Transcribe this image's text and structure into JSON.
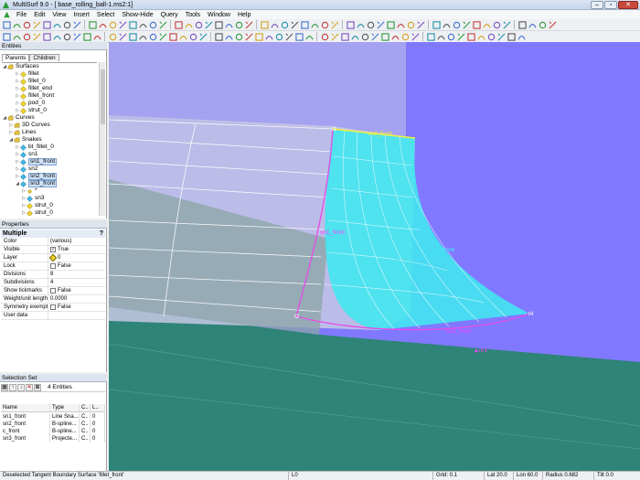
{
  "window": {
    "title": "MultiSurf 9.0 - [ base_rolling_ball-1.ms2:1]",
    "minimize": "–",
    "maximize": "▫",
    "close": "✕"
  },
  "menu": [
    "File",
    "Edit",
    "View",
    "Insert",
    "Select",
    "Show-Hide",
    "Query",
    "Tools",
    "Window",
    "Help"
  ],
  "entities": {
    "title": "Entities",
    "tabs": [
      "Parents",
      "Children"
    ],
    "tree": [
      {
        "label": "Surfaces",
        "icon": "folder-icon"
      },
      {
        "label": "fillet",
        "icon": "surface-icon"
      },
      {
        "label": "fillet_0",
        "icon": "surface-icon"
      },
      {
        "label": "fillet_end",
        "icon": "surface-icon"
      },
      {
        "label": "fillet_front",
        "icon": "surface-icon"
      },
      {
        "label": "pod_0",
        "icon": "surface-icon"
      },
      {
        "label": "strut_0",
        "icon": "surface-icon"
      },
      {
        "label": "Curves",
        "icon": "folder-icon"
      },
      {
        "label": "3D Curves",
        "icon": "folder-icon"
      },
      {
        "label": "Lines",
        "icon": "folder-icon"
      },
      {
        "label": "Snakes",
        "icon": "folder-icon"
      },
      {
        "label": "bt_fillet_0",
        "icon": "snake-icon"
      },
      {
        "label": "sn1",
        "icon": "snake-icon"
      },
      {
        "label": "sn1_front",
        "icon": "snake-icon"
      },
      {
        "label": "sn2",
        "icon": "snake-icon"
      },
      {
        "label": "sn2_front",
        "icon": "snake-icon"
      },
      {
        "label": "sn3_front",
        "icon": "snake-icon"
      },
      {
        "label": "*",
        "icon": "point-icon"
      },
      {
        "label": "sn3",
        "icon": "snake-icon"
      },
      {
        "label": "strut_0",
        "icon": "surface-icon"
      },
      {
        "label": "strut_0",
        "icon": "surface-icon"
      }
    ]
  },
  "properties": {
    "title": "Properties",
    "header": "Multiple",
    "rows": [
      {
        "key": "Color",
        "value": "(various)"
      },
      {
        "key": "Visible",
        "value": "True",
        "check": "✓"
      },
      {
        "key": "Layer",
        "value": "0"
      },
      {
        "key": "Lock",
        "value": "False",
        "check": ""
      },
      {
        "key": "Divisions",
        "value": "8"
      },
      {
        "key": "Subdivisions",
        "value": "4"
      },
      {
        "key": "Show tickmarks",
        "value": "False",
        "check": ""
      },
      {
        "key": "Weight/unit length",
        "value": "0.0000"
      },
      {
        "key": "Symmetry exempt",
        "value": "False",
        "check": ""
      },
      {
        "key": "User data",
        "value": ""
      }
    ]
  },
  "selection_set": {
    "title": "Selection Set",
    "count": "4 Entities",
    "columns": [
      "Name",
      "Type",
      "C..",
      "L.."
    ],
    "rows": [
      {
        "name": "sn1_front",
        "type": "Line Sna...",
        "c": "C..",
        "l": "0"
      },
      {
        "name": "sn2_front",
        "type": "B-spline...",
        "c": "C..",
        "l": "0"
      },
      {
        "name": "c_front",
        "type": "B-spline...",
        "c": "C..",
        "l": "0"
      },
      {
        "name": "sn3_front",
        "type": "Projecte...",
        "c": "C..",
        "l": "0"
      }
    ]
  },
  "viewport_labels": {
    "t1": "t1",
    "t2": "t2",
    "t4": "t4",
    "sn3_front": "sn3_front",
    "sn1_front": "sn1_front",
    "sn2_front": "sn2_front",
    "c_front": "c_front",
    "m1": "m1"
  },
  "status": {
    "message": "Deselected Tangent Boundary Surface 'fillet_front'",
    "layer": "L0",
    "grid": "Grid: 0.1",
    "lat": "Lat 20.0",
    "lon": "Lon 60.0",
    "radius": "Radius 0.682",
    "tilt": "Tilt 0.0"
  },
  "colors": {
    "viewport_bg": "#8079ff",
    "ground": "#2f8478",
    "fillet": "#42e6f0",
    "snake_curve": "#e34fe6",
    "label_yellow": "#f2f23a",
    "label_magenta": "#ff40ff"
  }
}
